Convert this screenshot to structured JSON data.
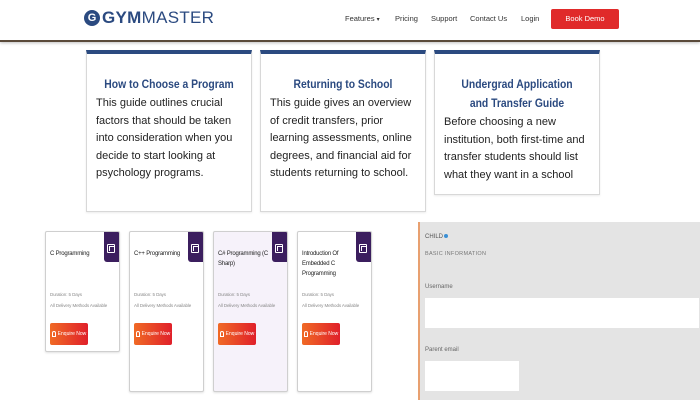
{
  "header": {
    "logo_mark": "G",
    "logo_gym": "GYM",
    "logo_master": "MASTER",
    "nav": [
      {
        "label": "Features",
        "dropdown": true
      },
      {
        "label": "Pricing",
        "dropdown": false
      },
      {
        "label": "Support",
        "dropdown": false
      },
      {
        "label": "Contact Us",
        "dropdown": false
      },
      {
        "label": "Login",
        "dropdown": false
      }
    ],
    "cta_label": "Book Demo",
    "brand_color": "#2b4a80",
    "cta_color": "#e02a2a"
  },
  "guides": [
    {
      "title": "How to Choose a Program",
      "body": "This guide outlines crucial factors that should be taken into consideration when you decide to start looking at psychology programs."
    },
    {
      "title": "Returning to School",
      "body": "This guide gives an overview of credit transfers, prior learning assessments, online degrees, and financial aid for students returning to school."
    },
    {
      "title": "Undergrad Application and Transfer Guide",
      "body": "Before choosing a new institution, both first-time and transfer students should list what they want in a school"
    }
  ],
  "courses": [
    {
      "title": "C Programming",
      "duration": "Duration: 5 Days",
      "delivery": "All Delivery Methods Available",
      "button": "Enquire Now"
    },
    {
      "title": "C++ Programming",
      "duration": "Duration: 5 Days",
      "delivery": "All Delivery Methods Available",
      "button": "Enquire Now"
    },
    {
      "title": "C# Programming (C Sharp)",
      "duration": "Duration: 5 Days",
      "delivery": "All Delivery Methods Available",
      "button": "Enquire Now"
    },
    {
      "title": "Introduction Of Embedded C Programming",
      "duration": "Duration: 5 Days",
      "delivery": "All Delivery Methods Available",
      "button": "Enquire Now"
    }
  ],
  "form": {
    "heading": "CHILD",
    "subheading": "BASIC INFORMATION",
    "fields": [
      {
        "label": "Username",
        "value": ""
      },
      {
        "label": "Parent email",
        "value": ""
      }
    ]
  }
}
